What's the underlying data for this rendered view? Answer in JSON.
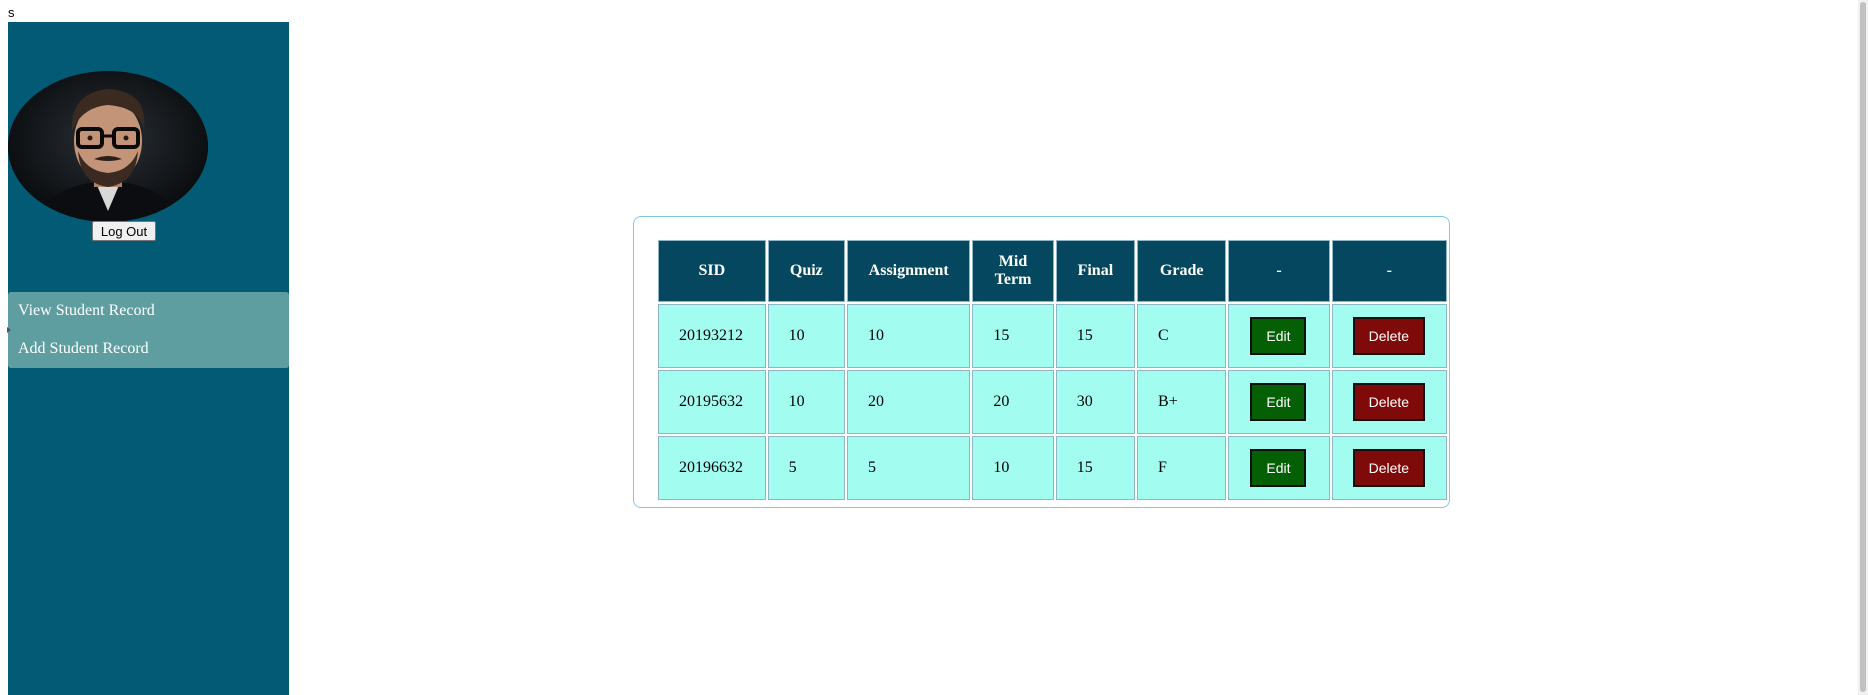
{
  "page": {
    "top_letter": "s"
  },
  "sidebar": {
    "logout_label": "Log Out",
    "menu": [
      {
        "label": "View Student Record"
      },
      {
        "label": "Add Student Record"
      }
    ]
  },
  "table": {
    "headers": [
      "SID",
      "Quiz",
      "Assignment",
      "Mid Term",
      "Final",
      "Grade",
      "-",
      "-"
    ],
    "rows": [
      {
        "sid": "20193212",
        "quiz": "10",
        "assignment": "10",
        "mid_term": "15",
        "final": "15",
        "grade": "C",
        "edit_label": "Edit",
        "delete_label": "Delete"
      },
      {
        "sid": "20195632",
        "quiz": "10",
        "assignment": "20",
        "mid_term": "20",
        "final": "30",
        "grade": "B+",
        "edit_label": "Edit",
        "delete_label": "Delete"
      },
      {
        "sid": "20196632",
        "quiz": "5",
        "assignment": "5",
        "mid_term": "10",
        "final": "15",
        "grade": "F",
        "edit_label": "Edit",
        "delete_label": "Delete"
      }
    ]
  },
  "colors": {
    "sidebar_bg": "#035a74",
    "menu_bg": "#5f9ea0",
    "header_bg": "#05475e",
    "cell_bg": "#a2fdf0",
    "edit_bg": "#056005",
    "delete_bg": "#7e0a0a"
  }
}
